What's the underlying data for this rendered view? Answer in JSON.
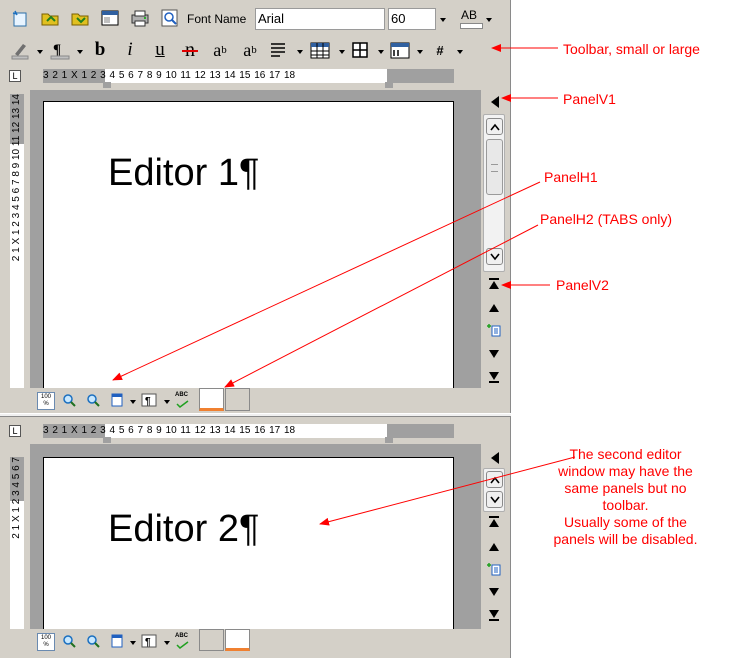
{
  "toolbar": {
    "font_name_label": "Font Name",
    "font_value": "Arial",
    "font_size_value": "60",
    "ab_label": "AB",
    "bold": "b",
    "italic": "i",
    "underline": "u",
    "strike": "n",
    "superscript_base": "a",
    "superscript_mark": "b",
    "subscript_base": "a",
    "subscript_mark": "b",
    "hash": "#"
  },
  "ruler": {
    "marks": "3 2 1 X 1 2 3 4 5 6 7 8 9 10 11 12 13 14 15 16 17 18",
    "corner": "L"
  },
  "vruler": {
    "marks_top": "2 1 X 1 2 3 4 5 6 7 8 9 10 11 12 13 14",
    "marks_bottom": "2 1 X 1 2 3 4 5 6 7"
  },
  "editor1": {
    "text": "Editor 1¶"
  },
  "editor2": {
    "text": "Editor 2¶"
  },
  "status": {
    "zoom_label": "100 %",
    "spell_label": "ABC"
  },
  "annotations": {
    "toolbar": "Toolbar, small or large",
    "panelv1": "PanelV1",
    "panelh1": "PanelH1",
    "panelh2": "PanelH2 (TABS only)",
    "panelv2": "PanelV2",
    "second_editor": [
      "The second editor",
      "window may have the",
      "same panels but no",
      "toolbar.",
      "Usually some of the",
      "panels will be disabled."
    ]
  },
  "colors": {
    "annotation": "#ff0000",
    "frame": "#d4d0c8",
    "page_background": "#a0a0a0",
    "tab_accent": "#f08030"
  }
}
